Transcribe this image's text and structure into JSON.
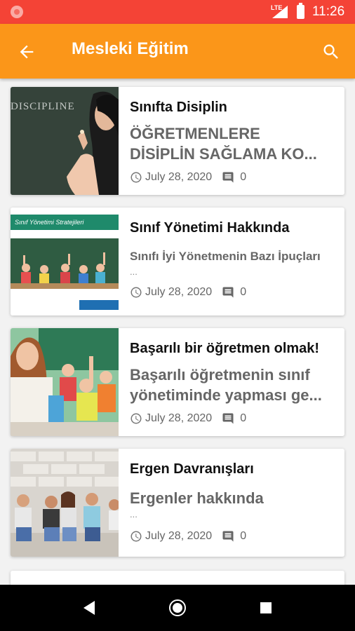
{
  "status_bar": {
    "network": "LTE",
    "time": "11:26"
  },
  "app_bar": {
    "title": "Mesleki Eğitim",
    "back_icon": "arrow-back-icon",
    "search_icon": "search-icon"
  },
  "colors": {
    "status_bar": "#f44336",
    "app_bar": "#fb9619"
  },
  "posts": [
    {
      "title": "Sınıfta Disiplin",
      "excerpt_lines": [
        "ÖĞRETMENLERE",
        "DİSİPLİN SAĞLAMA KO..."
      ],
      "more": "",
      "date": "July 28, 2020",
      "comments": "0",
      "thumb_label": "DISCIPLINE"
    },
    {
      "title": "Sınıf Yönetimi Hakkında",
      "excerpt_lines": [
        "Sınıfı İyi Yönetmenin Bazı İpuçları"
      ],
      "more": "...",
      "date": "July 28, 2020",
      "comments": "0",
      "thumb_label": "Sınıf Yönetimi Stratejileri"
    },
    {
      "title": "Başarılı bir öğretmen olmak!",
      "excerpt_lines": [
        "Başarılı öğretmenin sınıf",
        "yönetiminde yapması ge..."
      ],
      "more": "",
      "date": "July 28, 2020",
      "comments": "0",
      "thumb_label": ""
    },
    {
      "title": "Ergen Davranışları",
      "excerpt_lines": [
        "Ergenler hakkında"
      ],
      "more": "...",
      "date": "July 28, 2020",
      "comments": "0",
      "thumb_label": ""
    }
  ],
  "nav_bar": {
    "back": "nav-back-icon",
    "home": "nav-home-icon",
    "recents": "nav-recents-icon"
  }
}
